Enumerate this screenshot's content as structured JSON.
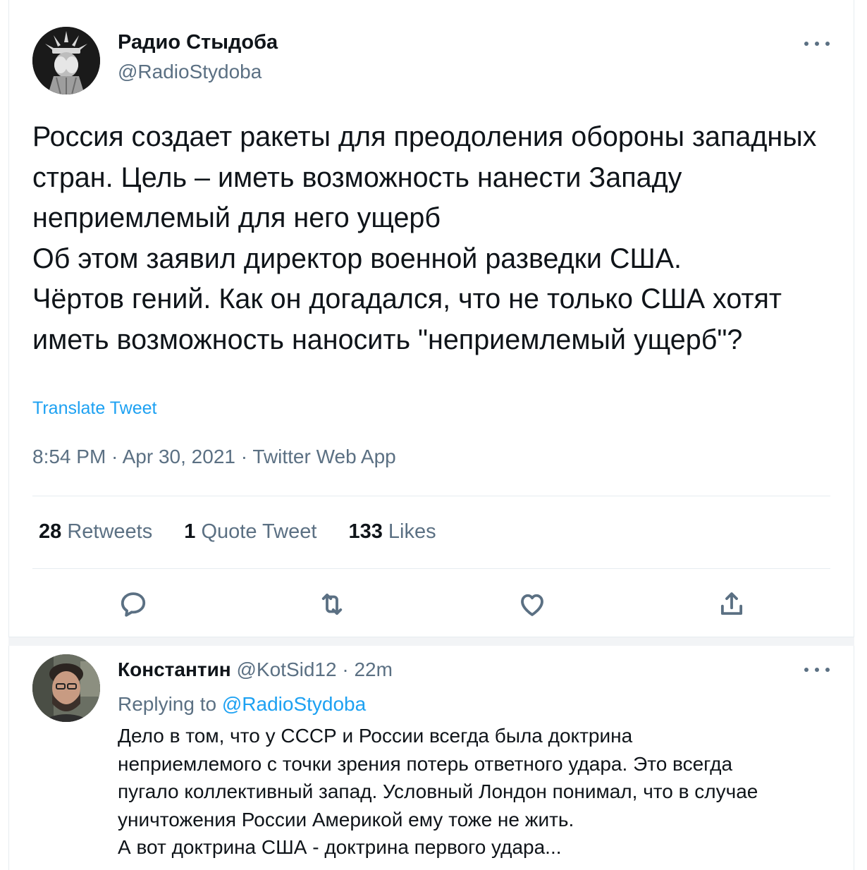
{
  "tweet": {
    "author": {
      "name": "Радио Стыдоба",
      "handle": "@RadioStydoba"
    },
    "text": "Россия создает ракеты для преодоления обороны западных стран. Цель – иметь возможность нанести Западу неприемлемый для него ущерб\nОб этом заявил директор военной разведки США.\nЧёртов гений. Как он догадался, что не только США хотят иметь возможность наносить \"неприемлемый ущерб\"?",
    "translate_label": "Translate Tweet",
    "time": "8:54 PM",
    "date": "Apr 30, 2021",
    "source": "Twitter Web App",
    "separator": " · ",
    "stats": {
      "retweets": {
        "count": "28",
        "label": "Retweets"
      },
      "quotes": {
        "count": "1",
        "label": "Quote Tweet"
      },
      "likes": {
        "count": "133",
        "label": "Likes"
      }
    },
    "actions": [
      "reply-icon",
      "retweet-icon",
      "like-icon",
      "share-icon"
    ]
  },
  "reply": {
    "author": {
      "name": "Константин",
      "handle": "@KotSid12"
    },
    "time": "22m",
    "separator": " · ",
    "replying_prefix": "Replying to ",
    "replying_to": "@RadioStydoba",
    "text": "Дело в том, что у СССР и России всегда была доктрина\nнеприемлемого с точки зрения потерь ответного удара. Это всегда\nпугало коллективный запад. Условный Лондон понимал, что в случае\nуничтожения России Америкой ему тоже не жить.\nА вот доктрина США - доктрина первого удара..."
  },
  "colors": {
    "text": "#0f1419",
    "muted": "#5b7083",
    "link": "#1da1f2",
    "border": "#e6ecf0"
  }
}
